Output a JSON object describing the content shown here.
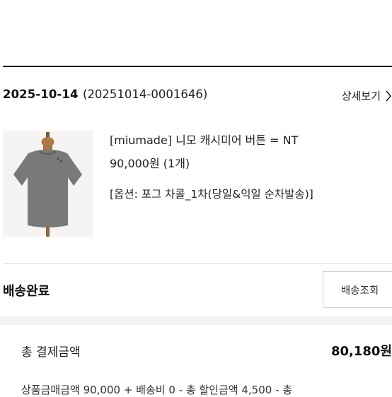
{
  "order": {
    "date": "2025-10-14",
    "number": "(20251014-0001646)",
    "detail_label": "상세보기"
  },
  "product": {
    "name": "[miumade] 니모 캐시미어 버튼 = NT",
    "price": "90,000원 (1개)",
    "option": "[옵션: 포그 차콜_1차(당일&익일 순차발송)]"
  },
  "delivery": {
    "status": "배송완료",
    "track_label": "배송조회"
  },
  "payment": {
    "total_label": "총 결제금액",
    "total_value": "80,180원",
    "breakdown": "상품금매금액 90,000 + 배송비 0 - 총 할인금액 4,500 - 총"
  },
  "colors": {
    "text": "#111111",
    "divider": "#d6d6d6",
    "band": "#f3f3f3"
  }
}
